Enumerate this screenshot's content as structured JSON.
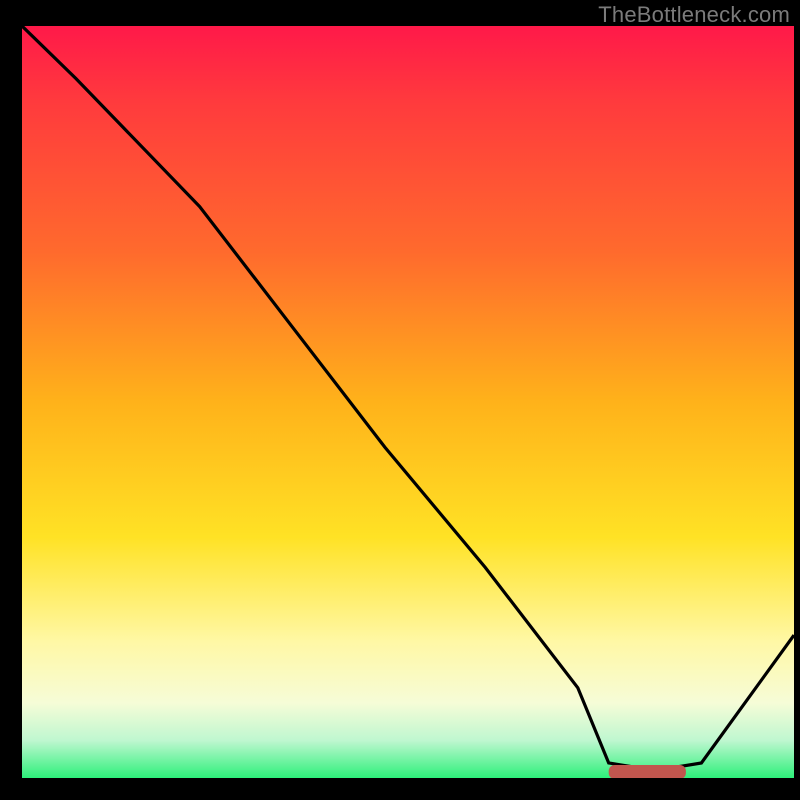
{
  "watermark": "TheBottleneck.com",
  "chart_data": {
    "type": "line",
    "title": "",
    "xlabel": "",
    "ylabel": "",
    "xlim": [
      0,
      100
    ],
    "ylim": [
      0,
      100
    ],
    "series": [
      {
        "name": "curve",
        "x": [
          0,
          7,
          23,
          35,
          47,
          60,
          72,
          76,
          82,
          88,
          100
        ],
        "values": [
          100,
          93,
          76,
          60,
          44,
          28,
          12,
          2,
          1,
          2,
          19
        ]
      }
    ],
    "marker": {
      "name": "optimal-band",
      "x_start": 76,
      "x_end": 86,
      "y": 0.8,
      "color": "#c1564e"
    },
    "gradient_stops": [
      {
        "pos": 0,
        "color": "#ff1949"
      },
      {
        "pos": 50,
        "color": "#ffb21a"
      },
      {
        "pos": 80,
        "color": "#fff8a6"
      },
      {
        "pos": 100,
        "color": "#2df07a"
      }
    ]
  }
}
